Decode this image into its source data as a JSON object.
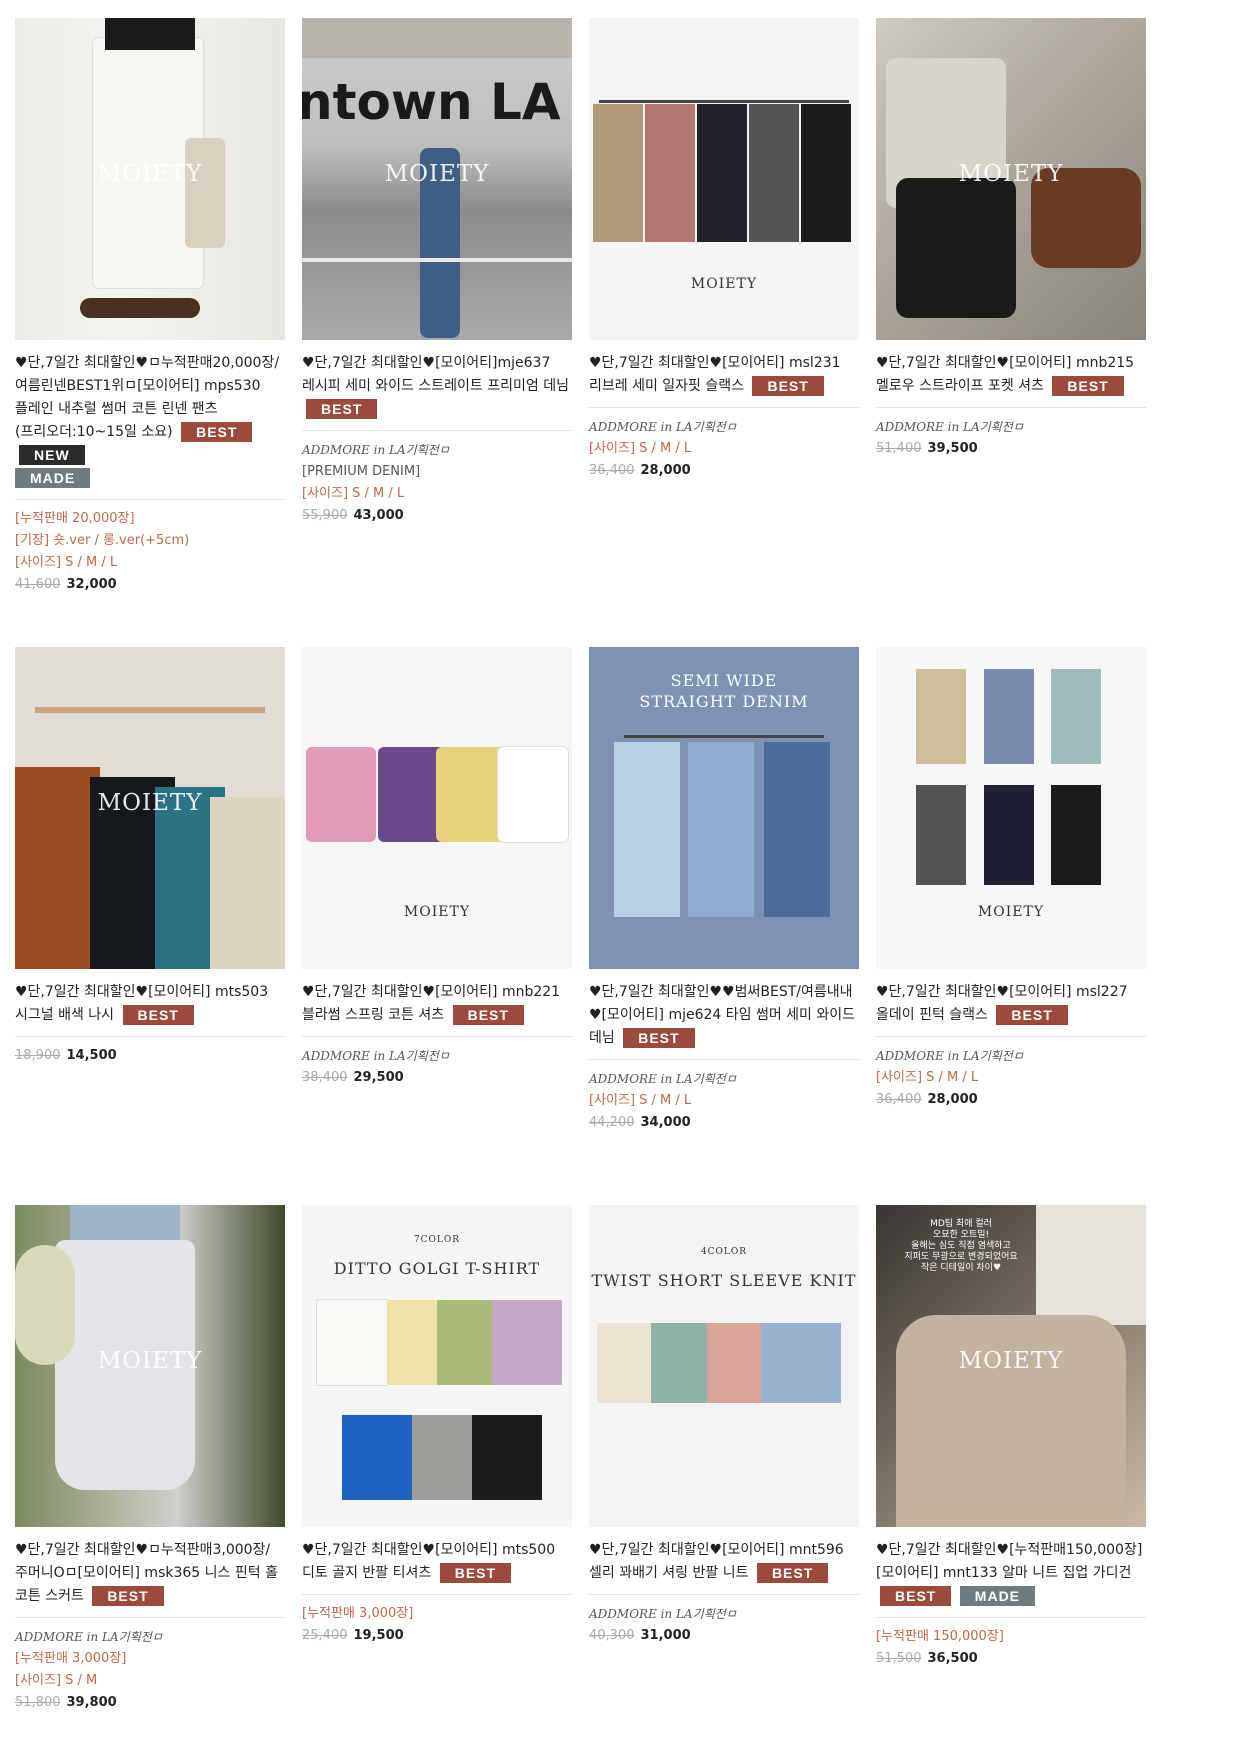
{
  "colors": {
    "best": "#9b4a3c",
    "new": "#2b2b2b",
    "made": "#6f7c7f",
    "accent_text": "#c0684a"
  },
  "products": [
    {
      "watermark": "MOIETY",
      "name": "♥단,7일간 최대할인♥ㅁ누적판매20,000장/여름린넨BEST1위ㅁ[모이어티] mps530 플레인 내추럴 썸머 코튼 린넨 팬츠(프리오더:10~15일 소요)",
      "badges": [
        "BEST",
        "NEW",
        "MADE"
      ],
      "lines": [
        "[누적판매 20,000장]",
        "[기장] 숏.ver / 롱.ver(+5cm)",
        "[사이즈] S / M / L"
      ],
      "old_price": "41,600",
      "price": "32,000"
    },
    {
      "watermark": "MOIETY",
      "sign_text": "ntown LA",
      "name": "♥단,7일간 최대할인♥[모이어티]mje637 레시피 세미 와이드 스트레이트 프리미엄 데님",
      "badges": [
        "BEST"
      ],
      "brand": "ADDMORE in LA기획전ㅁ",
      "lines": [
        "[PREMIUM DENIM]",
        "[사이즈] S / M / L"
      ],
      "old_price": "55,900",
      "price": "43,000"
    },
    {
      "brandmark": "MOIETY",
      "name": "♥단,7일간 최대할인♥[모이어티] msl231 리브레 세미 일자핏 슬랙스",
      "badges": [
        "BEST"
      ],
      "brand": "ADDMORE in LA기획전ㅁ",
      "lines": [
        "[사이즈] S / M / L"
      ],
      "old_price": "36,400",
      "price": "28,000"
    },
    {
      "watermark": "MOIETY",
      "name": "♥단,7일간 최대할인♥[모이어티] mnb215 멜로우 스트라이프 포켓 셔츠",
      "badges": [
        "BEST"
      ],
      "brand": "ADDMORE in LA기획전ㅁ",
      "lines": [],
      "old_price": "51,400",
      "price": "39,500"
    },
    {
      "watermark": "MOIETY",
      "name": "♥단,7일간 최대할인♥[모이어티] mts503 시그널 배색 나시",
      "badges": [
        "BEST"
      ],
      "lines": [],
      "old_price": "18,900",
      "price": "14,500"
    },
    {
      "brandmark": "MOIETY",
      "name": "♥단,7일간 최대할인♥[모이어티] mnb221 블라썸 스프링 코튼 셔츠",
      "badges": [
        "BEST"
      ],
      "brand": "ADDMORE in LA기획전ㅁ",
      "lines": [],
      "old_price": "38,400",
      "price": "29,500"
    },
    {
      "heading1": "SEMI WIDE",
      "heading2": "STRAIGHT DENIM",
      "name": "♥단,7일간 최대할인♥♥범써BEST/여름내내♥[모이어티] mje624 타임 썸머 세미 와이드 데님",
      "badges": [
        "BEST"
      ],
      "brand": "ADDMORE in LA기획전ㅁ",
      "lines": [
        "[사이즈] S / M / L"
      ],
      "old_price": "44,200",
      "price": "34,000"
    },
    {
      "brandmark": "MOIETY",
      "name": "♥단,7일간 최대할인♥[모이어티] msl227 올데이 핀턱 슬랙스",
      "badges": [
        "BEST"
      ],
      "brand": "ADDMORE in LA기획전ㅁ",
      "lines": [
        "[사이즈] S / M / L"
      ],
      "old_price": "36,400",
      "price": "28,000"
    },
    {
      "watermark": "MOIETY",
      "name": "♥단,7일간 최대할인♥ㅁ누적판매3,000장/주머니Oㅁ[모이어티] msk365 니스 핀턱 홀 코튼 스커트",
      "badges": [
        "BEST"
      ],
      "brand": "ADDMORE in LA기획전ㅁ",
      "lines": [
        "[누적판매 3,000장]",
        "[사이즈] S / M"
      ],
      "old_price": "51,800",
      "price": "39,800"
    },
    {
      "heading1": "DITTO GOLGI T-SHIRT",
      "tag": "7COLOR",
      "name": "♥단,7일간 최대할인♥[모이어티] mts500 디토 골지 반팔 티셔츠",
      "badges": [
        "BEST"
      ],
      "lines": [
        "[누적판매 3,000장]"
      ],
      "old_price": "25,400",
      "price": "19,500"
    },
    {
      "heading1": "TWIST SHORT SLEEVE KNIT",
      "tag": "4COLOR",
      "name": "♥단,7일간 최대할인♥[모이어티] mnt596 셀리 꽈배기 셔링 반팔 니트",
      "badges": [
        "BEST"
      ],
      "brand": "ADDMORE in LA기획전ㅁ",
      "lines": [],
      "old_price": "40,300",
      "price": "31,000"
    },
    {
      "watermark": "MOIETY",
      "overlay": "MD팀 최애 컬러\n오묘한 오트밀!\n올해는 심도 직접 염색하고\n지퍼도 무광으로 변경되었어요\n작은 디테일이 차이♥",
      "name": "♥단,7일간 최대할인♥[누적판매150,000장][모이어티] mnt133 알마 니트 집업 가디건",
      "badges": [
        "BEST",
        "MADE"
      ],
      "lines": [
        "[누적판매 150,000장]"
      ],
      "old_price": "51,500",
      "price": "36,500"
    }
  ]
}
